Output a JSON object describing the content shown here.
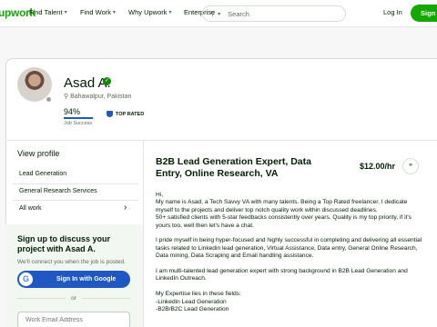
{
  "header": {
    "logo": "upwork",
    "nav": [
      {
        "label": "Find Talent"
      },
      {
        "label": "Find Work"
      },
      {
        "label": "Why Upwork"
      },
      {
        "label": "Enterprise"
      }
    ],
    "search_placeholder": "Search",
    "login": "Log In",
    "signup": "Sign"
  },
  "profile": {
    "name": "Asad A.",
    "location": "Bahawalpur, Pakistan",
    "job_success": "94%",
    "job_success_value": 0.94,
    "job_success_label": "Job Success",
    "badge": "TOP RATED"
  },
  "sidebar": {
    "view_profile": "View profile",
    "items": [
      {
        "label": "Lead Generation"
      },
      {
        "label": "General Research Services"
      },
      {
        "label": "All work"
      }
    ],
    "signup_title": "Sign up to discuss your project with Asad A.",
    "signup_sub": "We'll connect you when the job is posted.",
    "google_btn": "Sign In with Google",
    "or": "or",
    "email_placeholder": "Work Email Address"
  },
  "main": {
    "title": "B2B Lead Generation Expert, Data Entry, Online Research, VA",
    "rate": "$12.00/hr",
    "description": [
      "Hi,\nMy name is Asad, a Tech Savvy VA with many talents. Being a Top Rated freelancer, I dedicate myself to the projects and deliver top notch quality work within discussed deadlines.\n50+ satisfied clients with 5-star feedbacks consistently over years. Quality is my top priority, if it's yours too, well then let's have a chat.",
      "I pride myself in being hyper-focused and highly successful in completing and delivering all essential tasks related to Linkedin lead generation, Virtual Assistance, Data entry, General Online Research, Data mining, Data Scraping and Email handling assistance.",
      "I am multi-talented lead generation expert with strong background in B2B Lead Generation and LinkedIn Outreach.",
      "My Expertise lies in these fields:\n-Linkedin Lead Generation\n-B2B/B2C Lead Generation"
    ]
  }
}
